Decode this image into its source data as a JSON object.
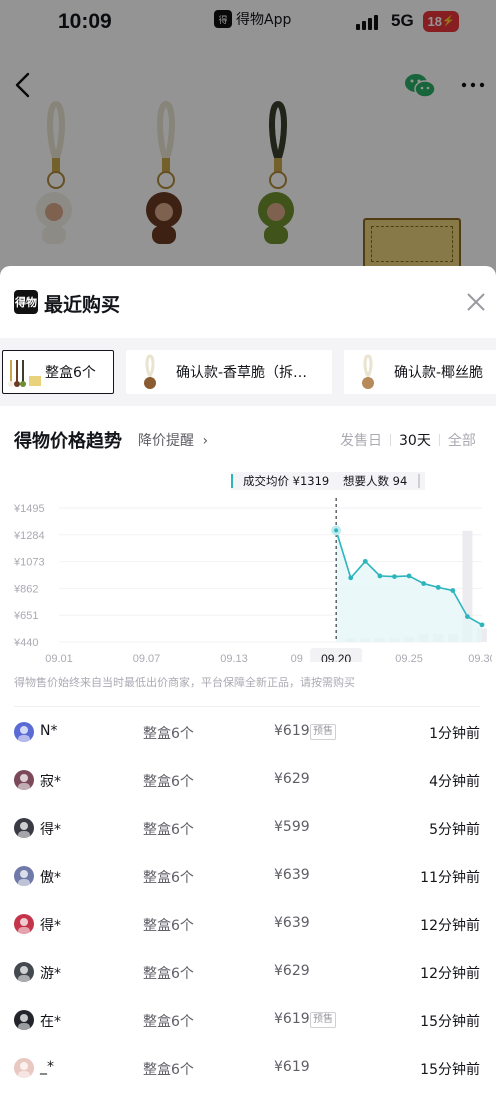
{
  "status_bar": {
    "time": "10:09",
    "app_name": "得物App",
    "network": "5G",
    "battery": "18"
  },
  "sheet": {
    "logo_text": "得物",
    "title": "最近购买"
  },
  "product_tabs": [
    {
      "label": "整盒6个",
      "active": true
    },
    {
      "label": "确认款-香草脆（拆…",
      "active": false
    },
    {
      "label": "确认款-椰丝脆",
      "active": false
    }
  ],
  "trend": {
    "title": "得物价格趋势",
    "alert_label": "降价提醒",
    "ranges": [
      "发售日",
      "30天",
      "全部"
    ],
    "selected_range": "30天",
    "tooltip": {
      "avg_label": "成交均价 ¥1319",
      "want_label": "想要人数 94"
    },
    "selected_date": "09.20",
    "note": "得物售价始终来自当时最低出价商家，平台保障全新正品，请按需购买"
  },
  "chart_data": {
    "type": "line",
    "ytick_labels": [
      "¥1495",
      "¥1284",
      "¥1073",
      "¥862",
      "¥651",
      "¥440"
    ],
    "yticks": [
      1495,
      1284,
      1073,
      862,
      651,
      440
    ],
    "ylim": [
      440,
      1495
    ],
    "xtick_labels": [
      "09.01",
      "09.07",
      "09.13",
      "09",
      "09.25",
      "09.30"
    ],
    "x_day_range": [
      1,
      30
    ],
    "series": [
      {
        "x": [
          20,
          21,
          22,
          23,
          24,
          25,
          26,
          27,
          28,
          29,
          30
        ],
        "values": [
          1319,
          945,
          1075,
          960,
          955,
          960,
          900,
          870,
          845,
          640,
          575
        ]
      }
    ],
    "volume_bars": {
      "x": [
        21,
        22,
        23,
        24,
        25,
        26,
        27,
        28,
        29,
        30
      ],
      "values": [
        0.03,
        0.03,
        0.03,
        0.03,
        0.04,
        0.06,
        0.06,
        0.06,
        0.83,
        0.1
      ]
    }
  },
  "recent_purchases": [
    {
      "name": "N*",
      "spec": "整盒6个",
      "price": "¥619",
      "badge": "预售",
      "ago": "1分钟前",
      "avatar_color": "#5b6bd6"
    },
    {
      "name": "寂*",
      "spec": "整盒6个",
      "price": "¥629",
      "badge": "",
      "ago": "4分钟前",
      "avatar_color": "#7a4a5a"
    },
    {
      "name": "得*",
      "spec": "整盒6个",
      "price": "¥599",
      "badge": "",
      "ago": "5分钟前",
      "avatar_color": "#3a3a44"
    },
    {
      "name": "傲*",
      "spec": "整盒6个",
      "price": "¥639",
      "badge": "",
      "ago": "11分钟前",
      "avatar_color": "#6f7aa8"
    },
    {
      "name": "得*",
      "spec": "整盒6个",
      "price": "¥639",
      "badge": "",
      "ago": "12分钟前",
      "avatar_color": "#c4344a"
    },
    {
      "name": "游*",
      "spec": "整盒6个",
      "price": "¥629",
      "badge": "",
      "ago": "12分钟前",
      "avatar_color": "#44484f"
    },
    {
      "name": "在*",
      "spec": "整盒6个",
      "price": "¥619",
      "badge": "预售",
      "ago": "15分钟前",
      "avatar_color": "#22252b"
    },
    {
      "name": "_*",
      "spec": "整盒6个",
      "price": "¥619",
      "badge": "",
      "ago": "15分钟前",
      "avatar_color": "#e8c8c0"
    }
  ],
  "colors": {
    "line": "#2bb5bd",
    "area": "#e6f6f8",
    "volume": "#ececf0",
    "accent": "#14151a"
  }
}
